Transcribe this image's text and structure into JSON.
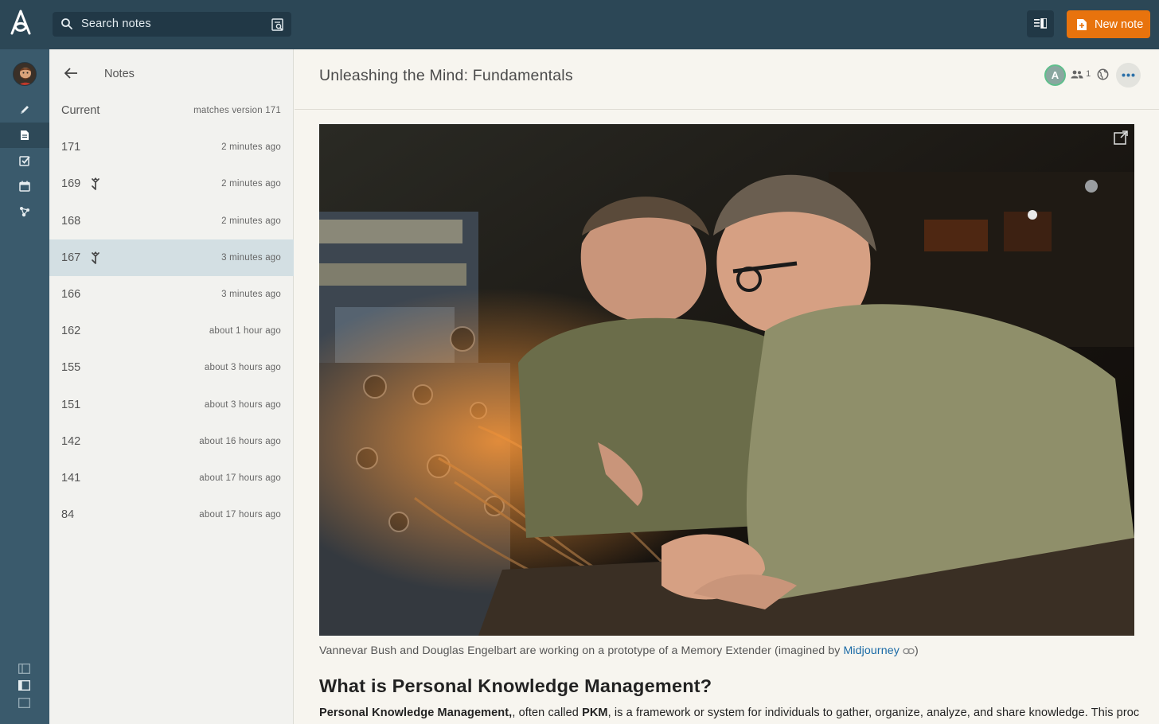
{
  "search": {
    "placeholder": "Search notes"
  },
  "toolbar": {
    "new_note_label": "New note"
  },
  "panel": {
    "title": "Notes",
    "versions": [
      {
        "label": "Current",
        "time": "matches version 171",
        "merge": false,
        "selected": false
      },
      {
        "label": "171",
        "time": "2 minutes ago",
        "merge": false,
        "selected": false
      },
      {
        "label": "169",
        "time": "2 minutes ago",
        "merge": true,
        "selected": false
      },
      {
        "label": "168",
        "time": "2 minutes ago",
        "merge": false,
        "selected": false
      },
      {
        "label": "167",
        "time": "3 minutes ago",
        "merge": true,
        "selected": true
      },
      {
        "label": "166",
        "time": "3 minutes ago",
        "merge": false,
        "selected": false
      },
      {
        "label": "162",
        "time": "about 1 hour ago",
        "merge": false,
        "selected": false
      },
      {
        "label": "155",
        "time": "about 3 hours ago",
        "merge": false,
        "selected": false
      },
      {
        "label": "151",
        "time": "about 3 hours ago",
        "merge": false,
        "selected": false
      },
      {
        "label": "142",
        "time": "about 16 hours ago",
        "merge": false,
        "selected": false
      },
      {
        "label": "141",
        "time": "about 17 hours ago",
        "merge": false,
        "selected": false
      },
      {
        "label": "84",
        "time": "about 17 hours ago",
        "merge": false,
        "selected": false
      }
    ]
  },
  "note": {
    "title": "Unleashing the Mind: Fundamentals",
    "collaborator_initial": "A",
    "share_count": "1",
    "caption_text": "Vannevar Bush and Douglas Engelbart are working on a prototype of a Memory Extender (imagined by ",
    "caption_link": "Midjourney",
    "caption_end": ")",
    "heading": "What is Personal Knowledge Management?",
    "para_1": "Personal Knowledge Management",
    "para_2": ", often called ",
    "para_3": "PKM",
    "para_4": ", is a framework or system for individuals to gather, organize, analyze, and share knowledge. This process"
  },
  "colors": {
    "topbar": "#2c4756",
    "rail": "#3a5a6c",
    "accent": "#e8730d",
    "selected_row": "#d3dfe3",
    "link": "#1a6aa6"
  },
  "icons": {
    "logo": "app-logo-icon",
    "rail": [
      "pencil-icon",
      "note-icon",
      "task-icon",
      "calendar-icon",
      "graph-icon"
    ]
  }
}
